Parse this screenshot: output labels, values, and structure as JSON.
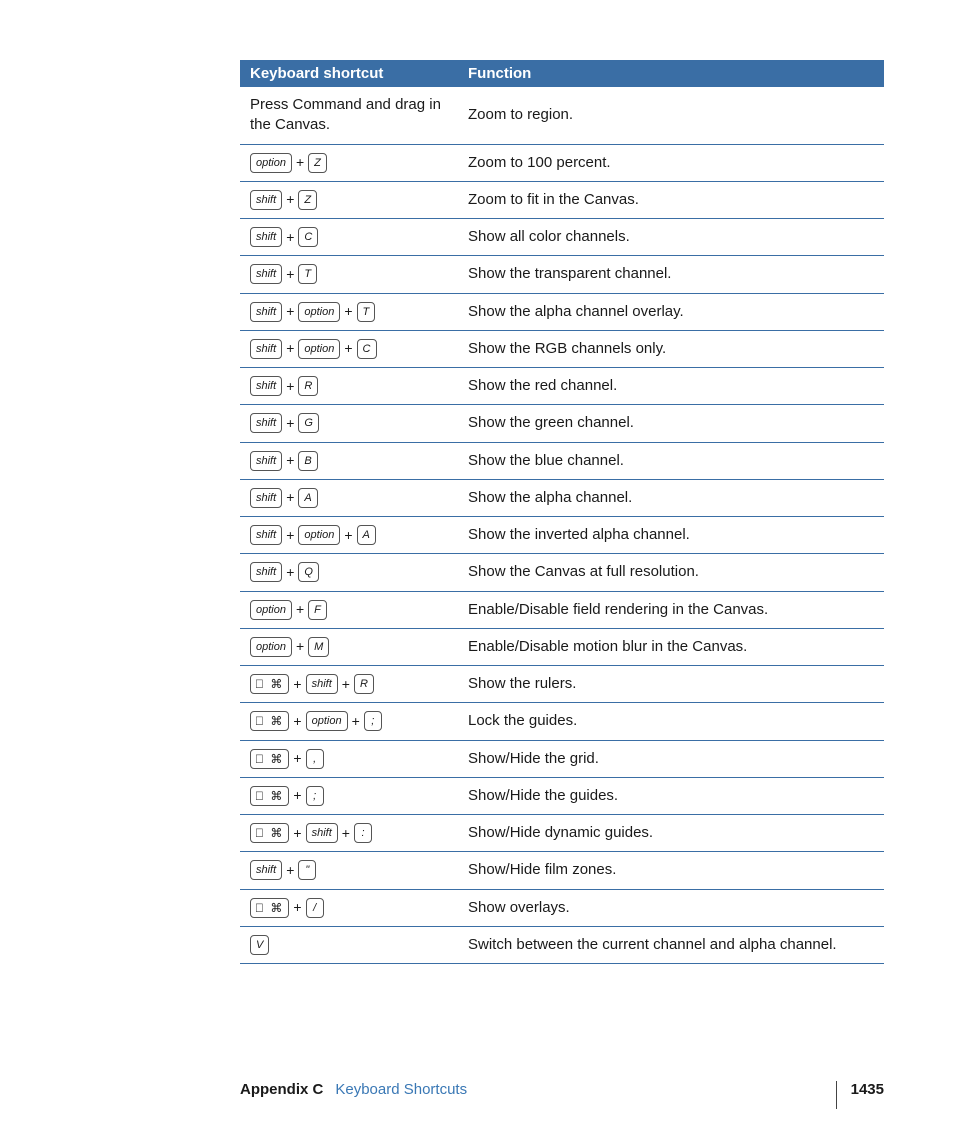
{
  "table": {
    "headers": {
      "shortcut": "Keyboard shortcut",
      "function": "Function"
    },
    "rows": [
      {
        "keys": [
          {
            "type": "text",
            "value": "Press Command and drag in the Canvas."
          }
        ],
        "func": "Zoom to region."
      },
      {
        "keys": [
          {
            "type": "key",
            "value": "option"
          },
          {
            "type": "plus"
          },
          {
            "type": "key",
            "value": "Z"
          }
        ],
        "func": "Zoom to 100 percent."
      },
      {
        "keys": [
          {
            "type": "key",
            "value": "shift"
          },
          {
            "type": "plus"
          },
          {
            "type": "key",
            "value": "Z"
          }
        ],
        "func": "Zoom to fit in the Canvas."
      },
      {
        "keys": [
          {
            "type": "key",
            "value": "shift"
          },
          {
            "type": "plus"
          },
          {
            "type": "key",
            "value": "C"
          }
        ],
        "func": "Show all color channels."
      },
      {
        "keys": [
          {
            "type": "key",
            "value": "shift"
          },
          {
            "type": "plus"
          },
          {
            "type": "key",
            "value": "T"
          }
        ],
        "func": "Show the transparent channel."
      },
      {
        "keys": [
          {
            "type": "key",
            "value": "shift"
          },
          {
            "type": "plus"
          },
          {
            "type": "key",
            "value": "option"
          },
          {
            "type": "plus"
          },
          {
            "type": "key",
            "value": "T"
          }
        ],
        "func": "Show the alpha channel overlay."
      },
      {
        "keys": [
          {
            "type": "key",
            "value": "shift"
          },
          {
            "type": "plus"
          },
          {
            "type": "key",
            "value": "option"
          },
          {
            "type": "plus"
          },
          {
            "type": "key",
            "value": "C"
          }
        ],
        "func": "Show the RGB channels only."
      },
      {
        "keys": [
          {
            "type": "key",
            "value": "shift"
          },
          {
            "type": "plus"
          },
          {
            "type": "key",
            "value": "R"
          }
        ],
        "func": "Show the red channel."
      },
      {
        "keys": [
          {
            "type": "key",
            "value": "shift"
          },
          {
            "type": "plus"
          },
          {
            "type": "key",
            "value": "G"
          }
        ],
        "func": "Show the green channel."
      },
      {
        "keys": [
          {
            "type": "key",
            "value": "shift"
          },
          {
            "type": "plus"
          },
          {
            "type": "key",
            "value": "B"
          }
        ],
        "func": "Show the blue channel."
      },
      {
        "keys": [
          {
            "type": "key",
            "value": "shift"
          },
          {
            "type": "plus"
          },
          {
            "type": "key",
            "value": "A"
          }
        ],
        "func": "Show the alpha channel."
      },
      {
        "keys": [
          {
            "type": "key",
            "value": "shift"
          },
          {
            "type": "plus"
          },
          {
            "type": "key",
            "value": "option"
          },
          {
            "type": "plus"
          },
          {
            "type": "key",
            "value": "A"
          }
        ],
        "func": "Show the inverted alpha channel."
      },
      {
        "keys": [
          {
            "type": "key",
            "value": "shift"
          },
          {
            "type": "plus"
          },
          {
            "type": "key",
            "value": "Q"
          }
        ],
        "func": "Show the Canvas at full resolution."
      },
      {
        "keys": [
          {
            "type": "key",
            "value": "option"
          },
          {
            "type": "plus"
          },
          {
            "type": "key",
            "value": "F"
          }
        ],
        "func": "Enable/Disable field rendering in the Canvas."
      },
      {
        "keys": [
          {
            "type": "key",
            "value": "option"
          },
          {
            "type": "plus"
          },
          {
            "type": "key",
            "value": "M"
          }
        ],
        "func": "Enable/Disable motion blur in the Canvas."
      },
      {
        "keys": [
          {
            "type": "cmd"
          },
          {
            "type": "plus"
          },
          {
            "type": "key",
            "value": "shift"
          },
          {
            "type": "plus"
          },
          {
            "type": "key",
            "value": "R"
          }
        ],
        "func": "Show the rulers."
      },
      {
        "keys": [
          {
            "type": "cmd"
          },
          {
            "type": "plus"
          },
          {
            "type": "key",
            "value": "option"
          },
          {
            "type": "plus"
          },
          {
            "type": "key",
            "value": ";"
          }
        ],
        "func": "Lock the guides."
      },
      {
        "keys": [
          {
            "type": "cmd"
          },
          {
            "type": "plus"
          },
          {
            "type": "key",
            "value": ","
          }
        ],
        "func": "Show/Hide the grid."
      },
      {
        "keys": [
          {
            "type": "cmd"
          },
          {
            "type": "plus"
          },
          {
            "type": "key",
            "value": ";"
          }
        ],
        "func": "Show/Hide the guides."
      },
      {
        "keys": [
          {
            "type": "cmd"
          },
          {
            "type": "plus"
          },
          {
            "type": "key",
            "value": "shift"
          },
          {
            "type": "plus"
          },
          {
            "type": "key",
            "value": ":"
          }
        ],
        "func": "Show/Hide dynamic guides."
      },
      {
        "keys": [
          {
            "type": "key",
            "value": "shift"
          },
          {
            "type": "plus"
          },
          {
            "type": "key",
            "value": "\""
          }
        ],
        "func": "Show/Hide film zones."
      },
      {
        "keys": [
          {
            "type": "cmd"
          },
          {
            "type": "plus"
          },
          {
            "type": "key",
            "value": "/"
          }
        ],
        "func": "Show overlays."
      },
      {
        "keys": [
          {
            "type": "key",
            "value": "V"
          }
        ],
        "func": "Switch between the current channel and alpha channel."
      }
    ]
  },
  "footer": {
    "appendix": "Appendix C",
    "title": "Keyboard Shortcuts",
    "page": "1435"
  },
  "glyphs": {
    "cmd": "⌘",
    "apple": ""
  }
}
